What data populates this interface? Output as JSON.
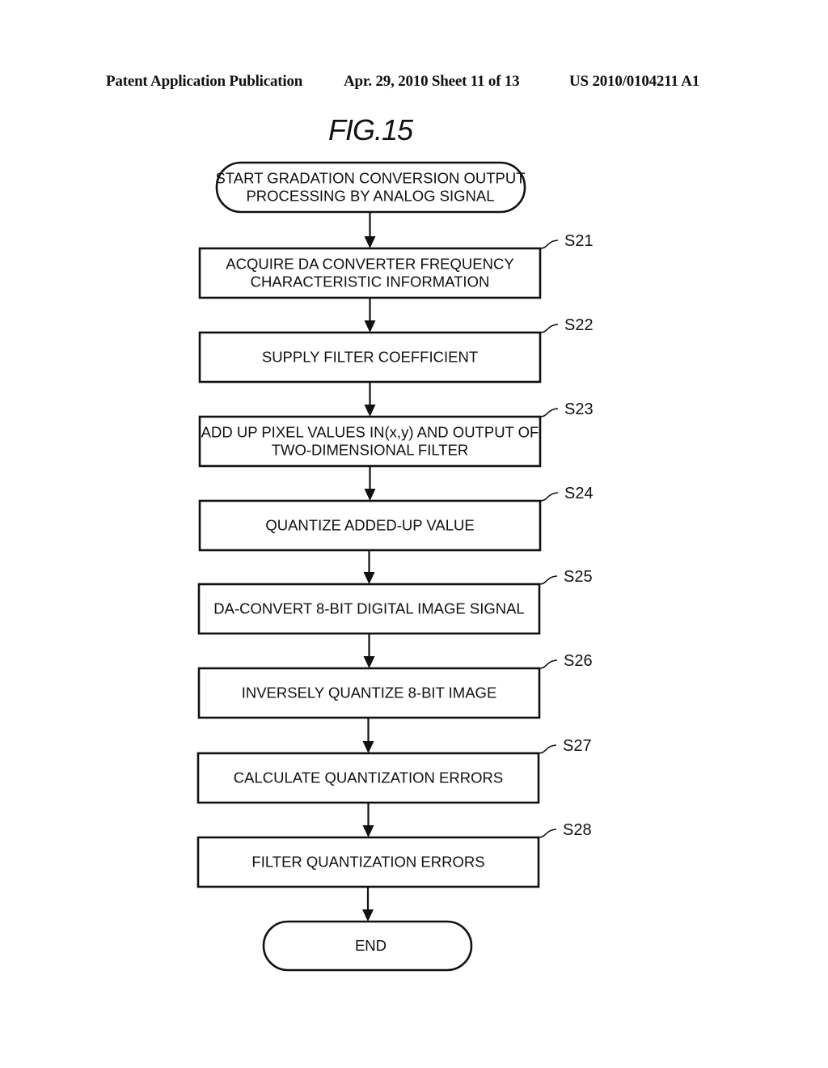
{
  "header": {
    "publication_type": "Patent Application Publication",
    "date_sheet": "Apr. 29, 2010  Sheet 11 of 13",
    "publication_number": "US 2010/0104211 A1"
  },
  "figure": {
    "title": "FIG.15"
  },
  "flowchart": {
    "start": {
      "lines": [
        "START GRADATION CONVERSION OUTPUT",
        "PROCESSING BY ANALOG SIGNAL"
      ]
    },
    "steps": [
      {
        "id": "S21",
        "lines": [
          "ACQUIRE DA CONVERTER FREQUENCY",
          "CHARACTERISTIC INFORMATION"
        ]
      },
      {
        "id": "S22",
        "lines": [
          "SUPPLY FILTER COEFFICIENT"
        ]
      },
      {
        "id": "S23",
        "lines": [
          "ADD UP PIXEL VALUES IN(x,y) AND OUTPUT OF",
          "TWO-DIMENSIONAL FILTER"
        ]
      },
      {
        "id": "S24",
        "lines": [
          "QUANTIZE ADDED-UP VALUE"
        ]
      },
      {
        "id": "S25",
        "lines": [
          "DA-CONVERT 8-BIT DIGITAL IMAGE SIGNAL"
        ]
      },
      {
        "id": "S26",
        "lines": [
          "INVERSELY QUANTIZE 8-BIT IMAGE"
        ]
      },
      {
        "id": "S27",
        "lines": [
          "CALCULATE QUANTIZATION ERRORS"
        ]
      },
      {
        "id": "S28",
        "lines": [
          "FILTER QUANTIZATION ERRORS"
        ]
      }
    ],
    "end": {
      "lines": [
        "END"
      ]
    }
  }
}
